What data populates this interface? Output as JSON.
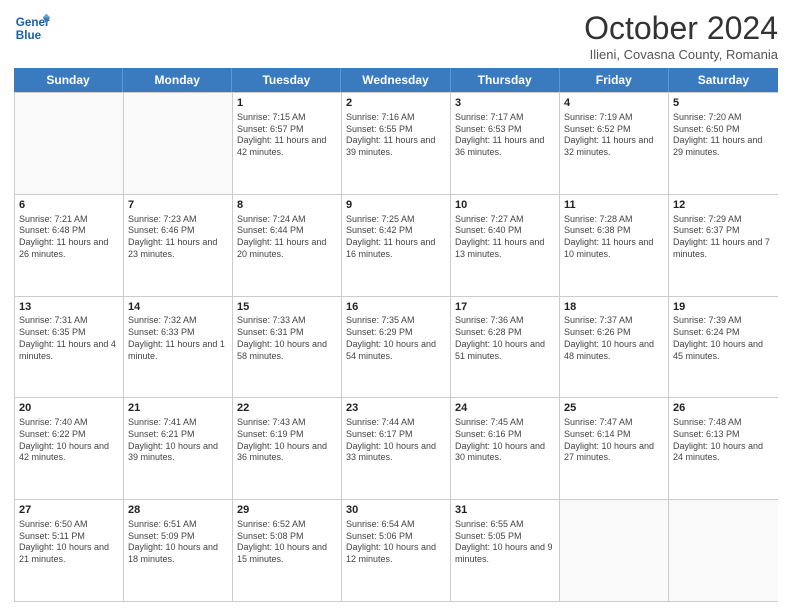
{
  "header": {
    "logo_line1": "General",
    "logo_line2": "Blue",
    "month_title": "October 2024",
    "subtitle": "Ilieni, Covasna County, Romania"
  },
  "days_of_week": [
    "Sunday",
    "Monday",
    "Tuesday",
    "Wednesday",
    "Thursday",
    "Friday",
    "Saturday"
  ],
  "rows": [
    [
      {
        "day": "",
        "sunrise": "",
        "sunset": "",
        "daylight": ""
      },
      {
        "day": "",
        "sunrise": "",
        "sunset": "",
        "daylight": ""
      },
      {
        "day": "1",
        "sunrise": "Sunrise: 7:15 AM",
        "sunset": "Sunset: 6:57 PM",
        "daylight": "Daylight: 11 hours and 42 minutes."
      },
      {
        "day": "2",
        "sunrise": "Sunrise: 7:16 AM",
        "sunset": "Sunset: 6:55 PM",
        "daylight": "Daylight: 11 hours and 39 minutes."
      },
      {
        "day": "3",
        "sunrise": "Sunrise: 7:17 AM",
        "sunset": "Sunset: 6:53 PM",
        "daylight": "Daylight: 11 hours and 36 minutes."
      },
      {
        "day": "4",
        "sunrise": "Sunrise: 7:19 AM",
        "sunset": "Sunset: 6:52 PM",
        "daylight": "Daylight: 11 hours and 32 minutes."
      },
      {
        "day": "5",
        "sunrise": "Sunrise: 7:20 AM",
        "sunset": "Sunset: 6:50 PM",
        "daylight": "Daylight: 11 hours and 29 minutes."
      }
    ],
    [
      {
        "day": "6",
        "sunrise": "Sunrise: 7:21 AM",
        "sunset": "Sunset: 6:48 PM",
        "daylight": "Daylight: 11 hours and 26 minutes."
      },
      {
        "day": "7",
        "sunrise": "Sunrise: 7:23 AM",
        "sunset": "Sunset: 6:46 PM",
        "daylight": "Daylight: 11 hours and 23 minutes."
      },
      {
        "day": "8",
        "sunrise": "Sunrise: 7:24 AM",
        "sunset": "Sunset: 6:44 PM",
        "daylight": "Daylight: 11 hours and 20 minutes."
      },
      {
        "day": "9",
        "sunrise": "Sunrise: 7:25 AM",
        "sunset": "Sunset: 6:42 PM",
        "daylight": "Daylight: 11 hours and 16 minutes."
      },
      {
        "day": "10",
        "sunrise": "Sunrise: 7:27 AM",
        "sunset": "Sunset: 6:40 PM",
        "daylight": "Daylight: 11 hours and 13 minutes."
      },
      {
        "day": "11",
        "sunrise": "Sunrise: 7:28 AM",
        "sunset": "Sunset: 6:38 PM",
        "daylight": "Daylight: 11 hours and 10 minutes."
      },
      {
        "day": "12",
        "sunrise": "Sunrise: 7:29 AM",
        "sunset": "Sunset: 6:37 PM",
        "daylight": "Daylight: 11 hours and 7 minutes."
      }
    ],
    [
      {
        "day": "13",
        "sunrise": "Sunrise: 7:31 AM",
        "sunset": "Sunset: 6:35 PM",
        "daylight": "Daylight: 11 hours and 4 minutes."
      },
      {
        "day": "14",
        "sunrise": "Sunrise: 7:32 AM",
        "sunset": "Sunset: 6:33 PM",
        "daylight": "Daylight: 11 hours and 1 minute."
      },
      {
        "day": "15",
        "sunrise": "Sunrise: 7:33 AM",
        "sunset": "Sunset: 6:31 PM",
        "daylight": "Daylight: 10 hours and 58 minutes."
      },
      {
        "day": "16",
        "sunrise": "Sunrise: 7:35 AM",
        "sunset": "Sunset: 6:29 PM",
        "daylight": "Daylight: 10 hours and 54 minutes."
      },
      {
        "day": "17",
        "sunrise": "Sunrise: 7:36 AM",
        "sunset": "Sunset: 6:28 PM",
        "daylight": "Daylight: 10 hours and 51 minutes."
      },
      {
        "day": "18",
        "sunrise": "Sunrise: 7:37 AM",
        "sunset": "Sunset: 6:26 PM",
        "daylight": "Daylight: 10 hours and 48 minutes."
      },
      {
        "day": "19",
        "sunrise": "Sunrise: 7:39 AM",
        "sunset": "Sunset: 6:24 PM",
        "daylight": "Daylight: 10 hours and 45 minutes."
      }
    ],
    [
      {
        "day": "20",
        "sunrise": "Sunrise: 7:40 AM",
        "sunset": "Sunset: 6:22 PM",
        "daylight": "Daylight: 10 hours and 42 minutes."
      },
      {
        "day": "21",
        "sunrise": "Sunrise: 7:41 AM",
        "sunset": "Sunset: 6:21 PM",
        "daylight": "Daylight: 10 hours and 39 minutes."
      },
      {
        "day": "22",
        "sunrise": "Sunrise: 7:43 AM",
        "sunset": "Sunset: 6:19 PM",
        "daylight": "Daylight: 10 hours and 36 minutes."
      },
      {
        "day": "23",
        "sunrise": "Sunrise: 7:44 AM",
        "sunset": "Sunset: 6:17 PM",
        "daylight": "Daylight: 10 hours and 33 minutes."
      },
      {
        "day": "24",
        "sunrise": "Sunrise: 7:45 AM",
        "sunset": "Sunset: 6:16 PM",
        "daylight": "Daylight: 10 hours and 30 minutes."
      },
      {
        "day": "25",
        "sunrise": "Sunrise: 7:47 AM",
        "sunset": "Sunset: 6:14 PM",
        "daylight": "Daylight: 10 hours and 27 minutes."
      },
      {
        "day": "26",
        "sunrise": "Sunrise: 7:48 AM",
        "sunset": "Sunset: 6:13 PM",
        "daylight": "Daylight: 10 hours and 24 minutes."
      }
    ],
    [
      {
        "day": "27",
        "sunrise": "Sunrise: 6:50 AM",
        "sunset": "Sunset: 5:11 PM",
        "daylight": "Daylight: 10 hours and 21 minutes."
      },
      {
        "day": "28",
        "sunrise": "Sunrise: 6:51 AM",
        "sunset": "Sunset: 5:09 PM",
        "daylight": "Daylight: 10 hours and 18 minutes."
      },
      {
        "day": "29",
        "sunrise": "Sunrise: 6:52 AM",
        "sunset": "Sunset: 5:08 PM",
        "daylight": "Daylight: 10 hours and 15 minutes."
      },
      {
        "day": "30",
        "sunrise": "Sunrise: 6:54 AM",
        "sunset": "Sunset: 5:06 PM",
        "daylight": "Daylight: 10 hours and 12 minutes."
      },
      {
        "day": "31",
        "sunrise": "Sunrise: 6:55 AM",
        "sunset": "Sunset: 5:05 PM",
        "daylight": "Daylight: 10 hours and 9 minutes."
      },
      {
        "day": "",
        "sunrise": "",
        "sunset": "",
        "daylight": ""
      },
      {
        "day": "",
        "sunrise": "",
        "sunset": "",
        "daylight": ""
      }
    ]
  ]
}
